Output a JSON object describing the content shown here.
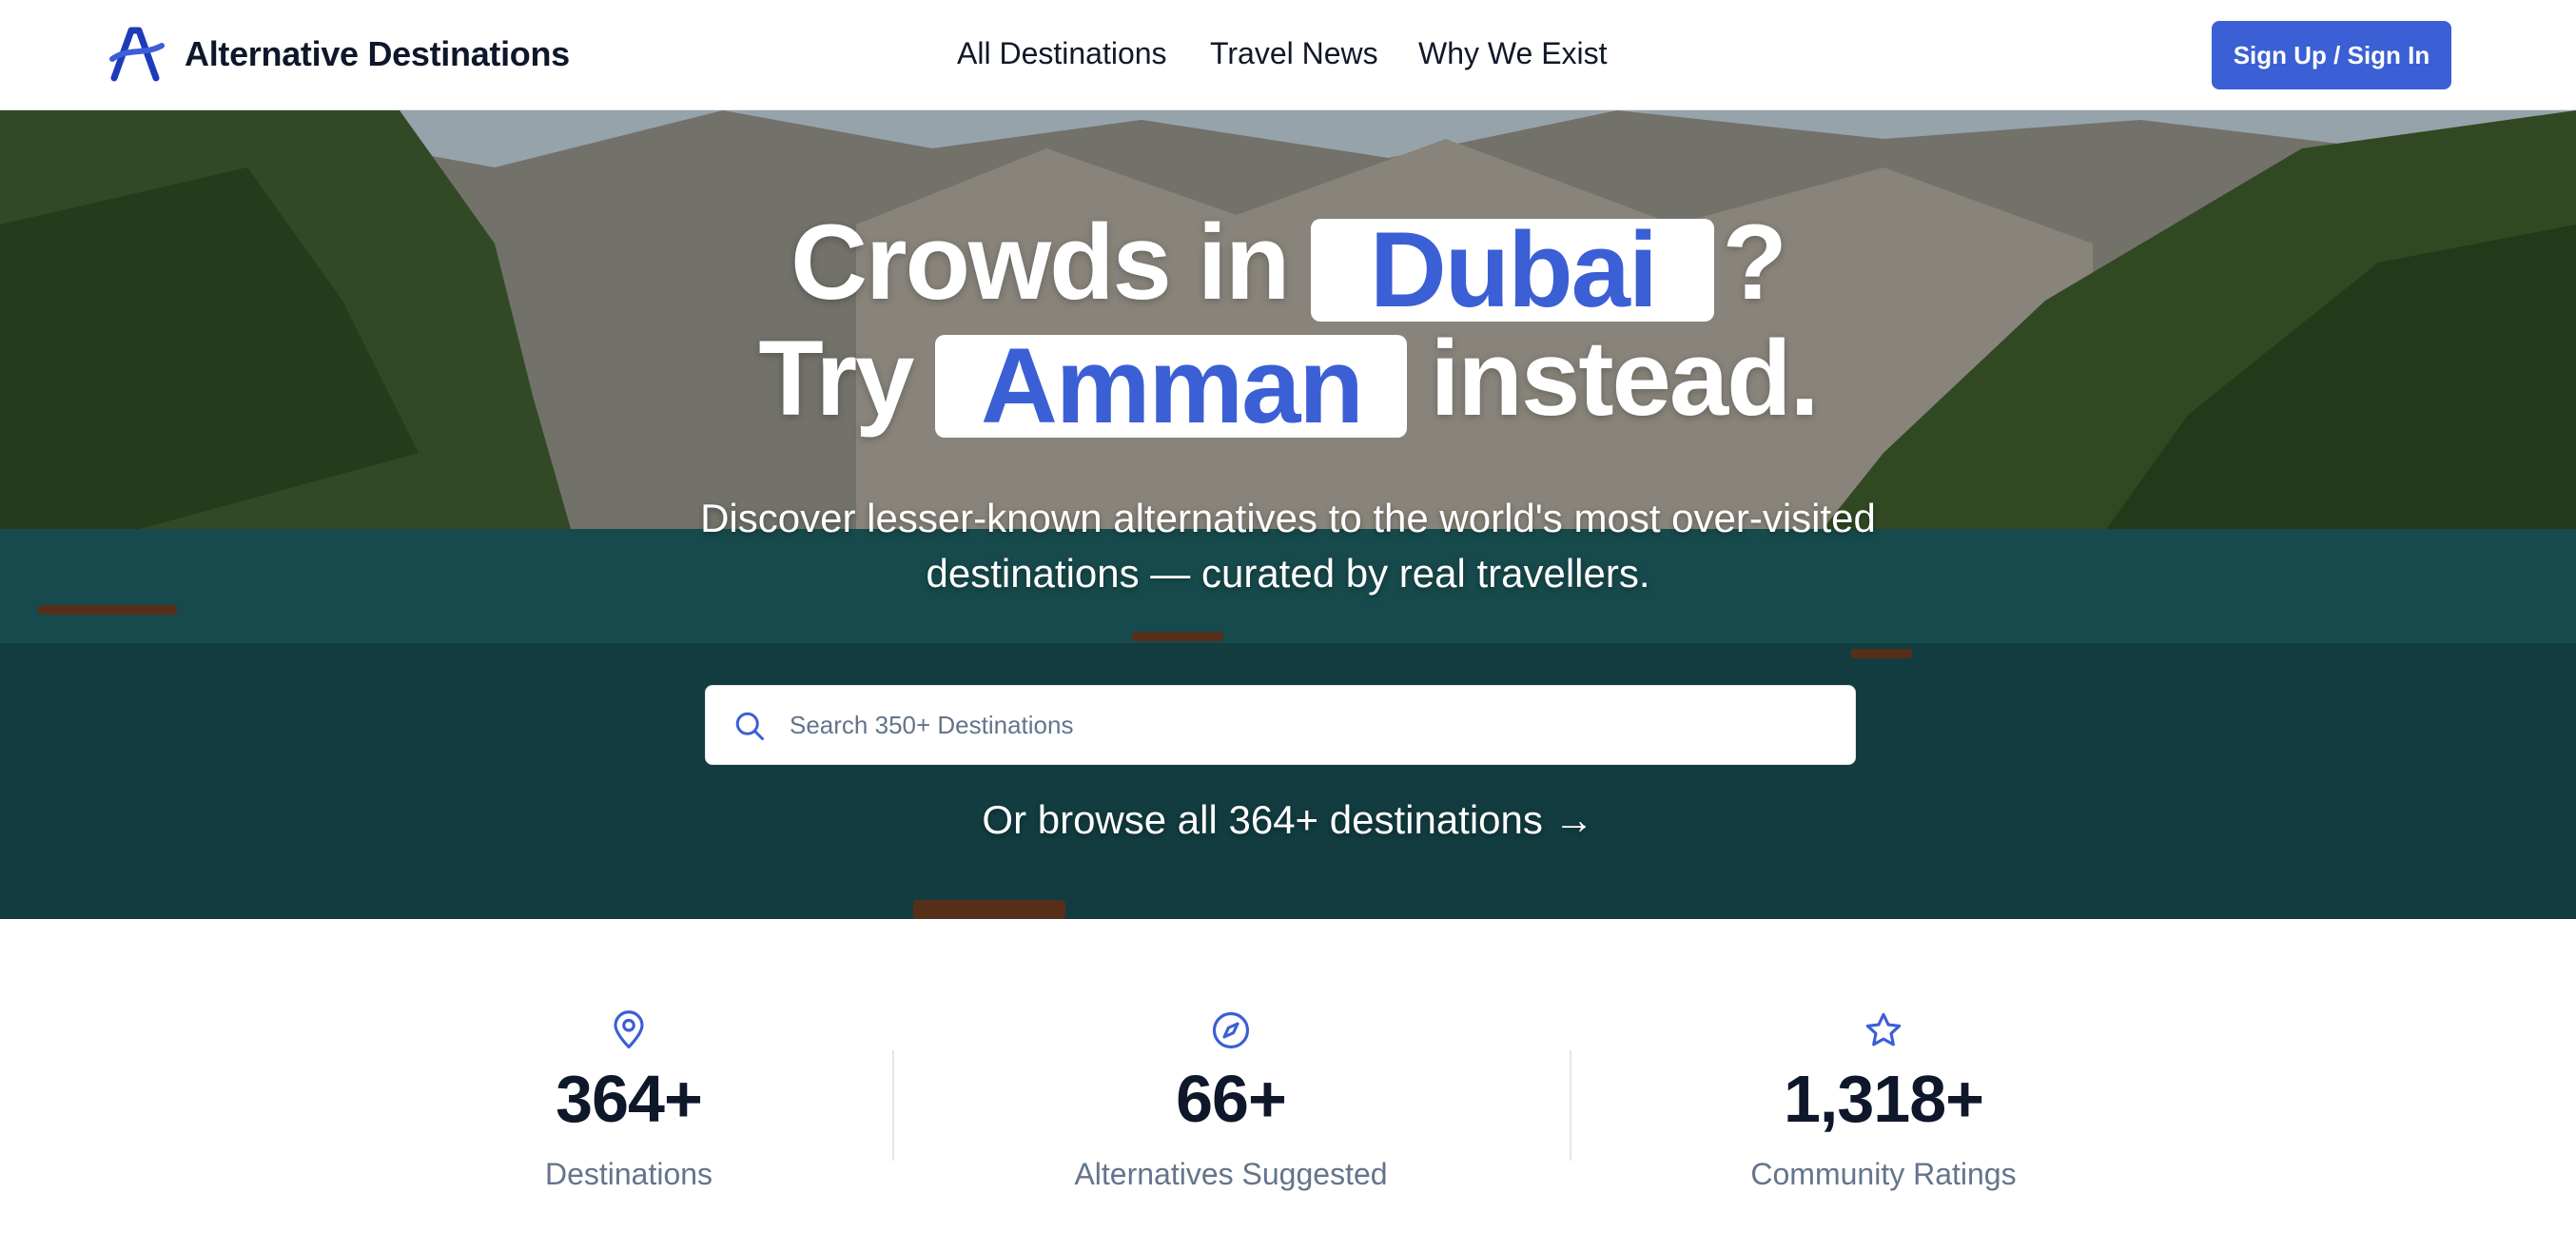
{
  "header": {
    "brand": "Alternative Destinations",
    "nav": [
      "All Destinations",
      "Travel News",
      "Why We Exist"
    ],
    "signup_label": "Sign Up / Sign In",
    "accent_color": "#3b5fd4"
  },
  "hero": {
    "headline_prefix": "Crowds in",
    "crowded_destination": "Dubai",
    "headline_question": "?",
    "try_word": "Try",
    "alternative_destination": "Amman",
    "headline_suffix": "instead.",
    "subtext": "Discover lesser-known alternatives to the world's most over-visited destinations — curated by real travellers.",
    "search_placeholder": "Search 350+ Destinations",
    "browse_link": "Or browse all 364+ destinations →"
  },
  "stats": [
    {
      "icon": "map-pin-icon",
      "value": "364+",
      "label": "Destinations"
    },
    {
      "icon": "compass-icon",
      "value": "66+",
      "label": "Alternatives Suggested"
    },
    {
      "icon": "star-icon",
      "value": "1,318+",
      "label": "Community Ratings"
    }
  ]
}
